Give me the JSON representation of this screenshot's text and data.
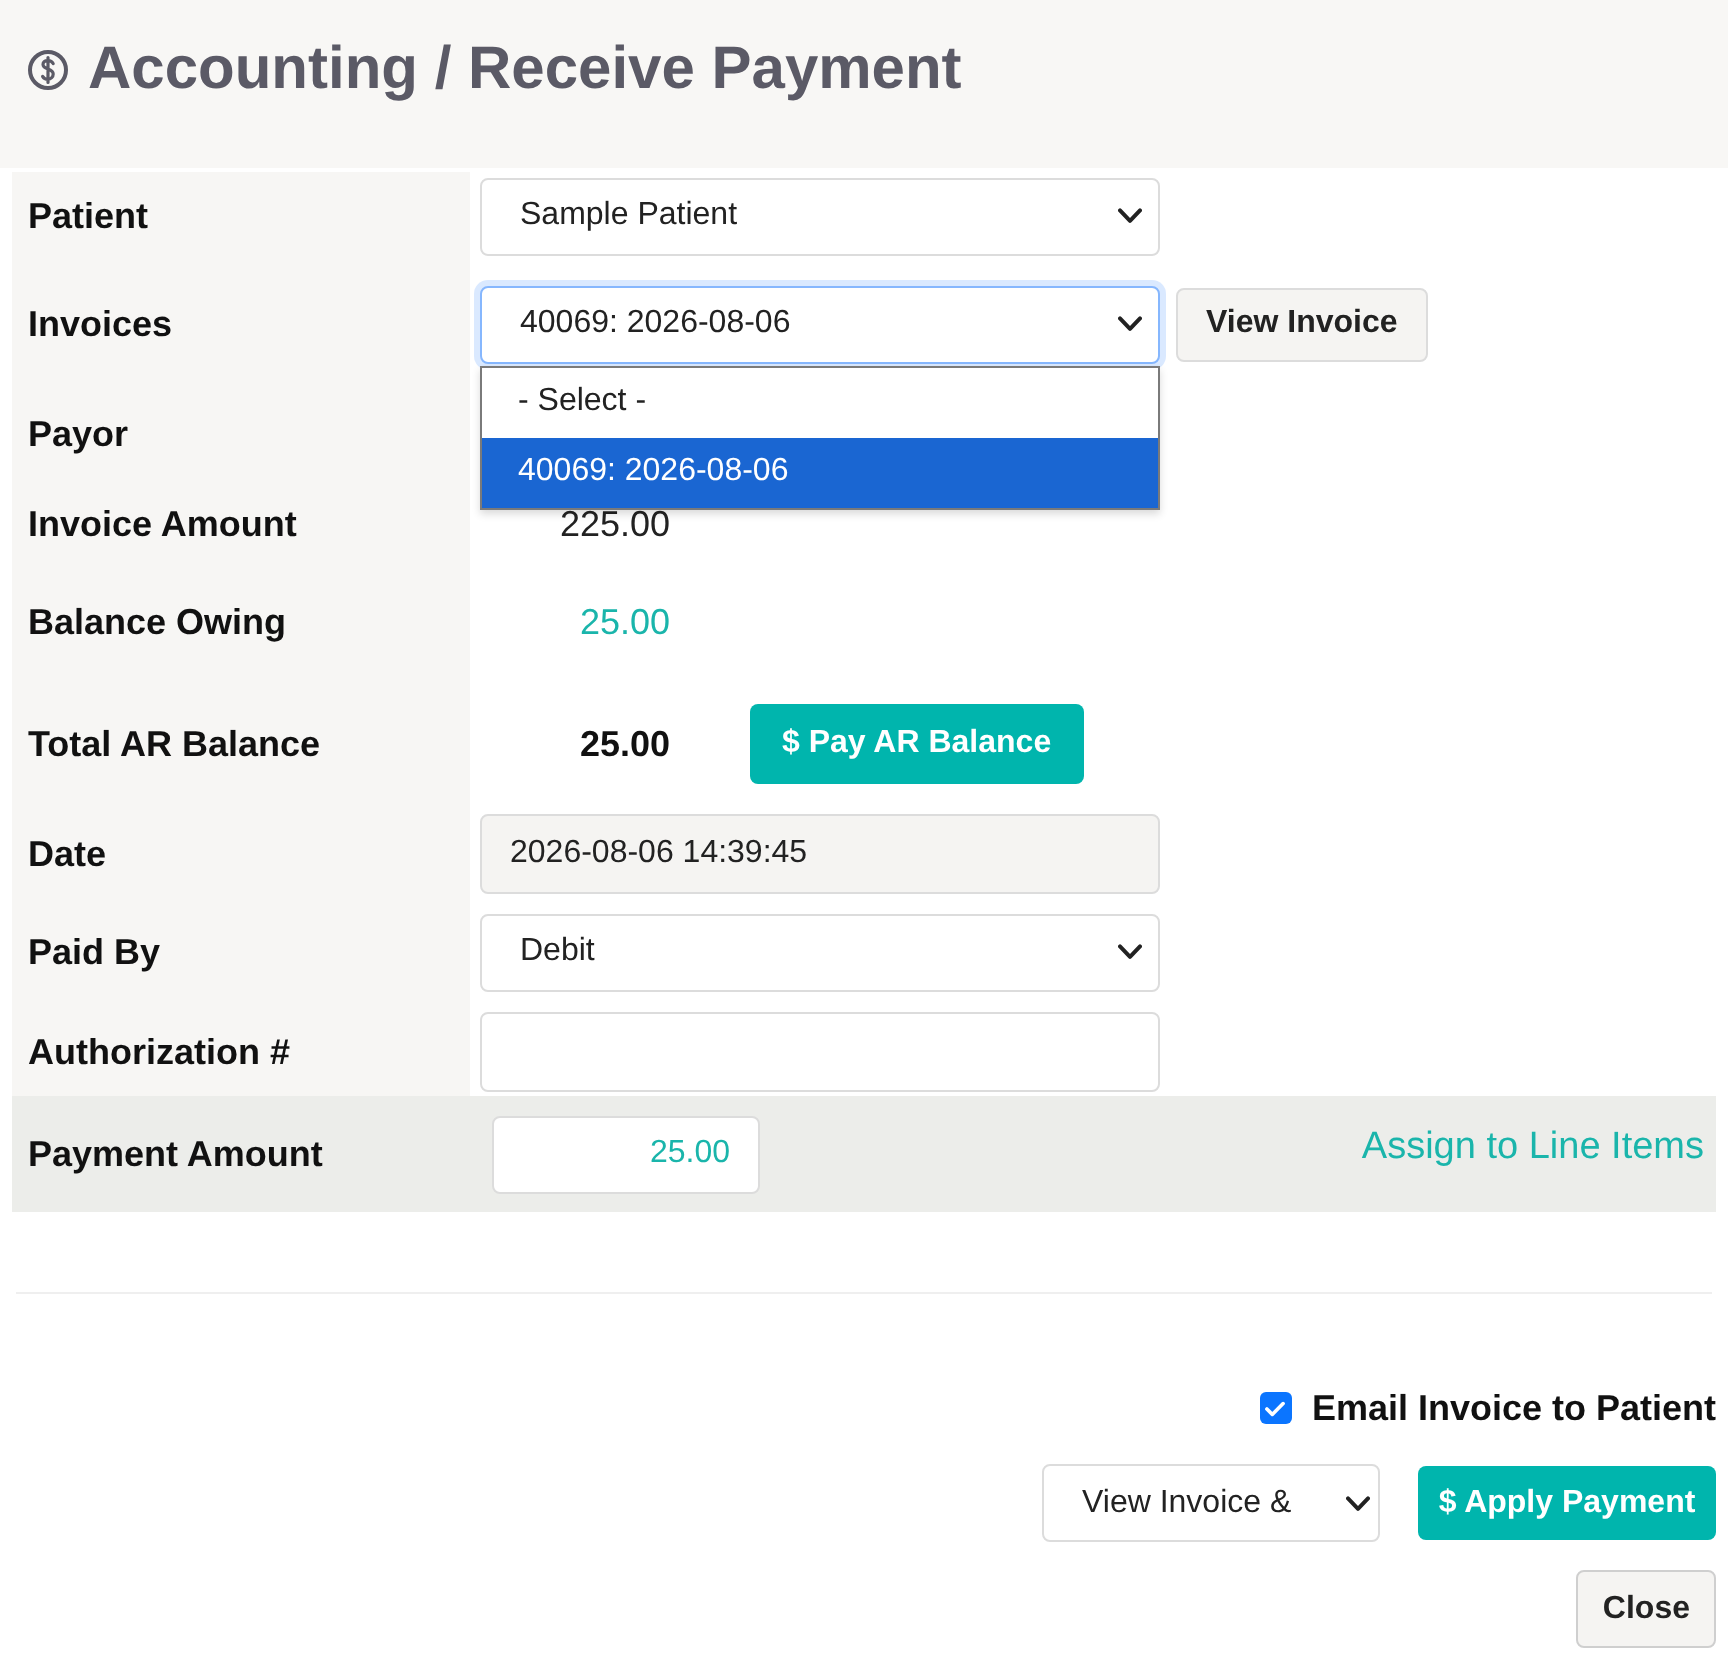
{
  "page": {
    "title": "Accounting / Receive Payment"
  },
  "form": {
    "rows": [
      {
        "kind": "select",
        "label": "Patient",
        "value": "Sample Patient",
        "focused": false
      },
      {
        "kind": "select",
        "label": "Invoices",
        "value": "40069: 2026-08-06",
        "focused": true,
        "button": "View Invoice",
        "dropdown": {
          "options": [
            {
              "label": "- Select -",
              "selected": false
            },
            {
              "label": "40069: 2026-08-06",
              "selected": true
            }
          ]
        }
      },
      {
        "kind": "text",
        "label": "Payor"
      },
      {
        "kind": "amount",
        "label": "Invoice Amount",
        "value": "225.00"
      },
      {
        "kind": "highlight",
        "label": "Balance Owing",
        "value": "25.00"
      },
      {
        "kind": "total",
        "label": "Total AR Balance",
        "value": "25.00",
        "button": "$ Pay AR Balance"
      },
      {
        "kind": "input",
        "label": "Date",
        "value": "2026-08-06 14:39:45",
        "readonly": true,
        "focused": false
      },
      {
        "kind": "select",
        "label": "Paid By",
        "value": "Debit",
        "focused": false
      },
      {
        "kind": "input",
        "label": "Authorization #",
        "readonly": false,
        "focused": false
      }
    ]
  },
  "payment": {
    "label": "Payment Amount",
    "value": "25.00",
    "link": "Assign to Line Items"
  },
  "footer": {
    "email_invoice": {
      "label": "Email Invoice to Patient",
      "checked": true
    },
    "action_select": {
      "value": "View Invoice &"
    },
    "apply_button": {
      "label": "$ Apply Payment"
    },
    "close_button": {
      "label": "Close"
    }
  }
}
